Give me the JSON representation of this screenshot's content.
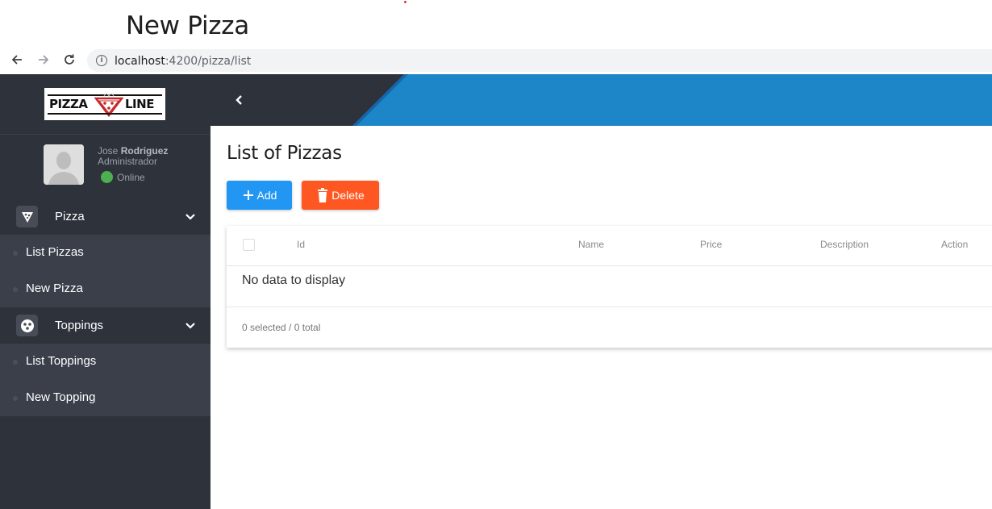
{
  "caption": {
    "title": "New Pizza"
  },
  "browser": {
    "url_host": "localhost",
    "url_path": ":4200/pizza/list"
  },
  "sidebar": {
    "logo": {
      "left_text": "PIZZA",
      "right_text": "LINE"
    },
    "user": {
      "first_name": "Jose",
      "last_name": "Rodriguez",
      "role": "Administrador",
      "status": "Online"
    },
    "groups": [
      {
        "label": "Pizza",
        "icon": "pizza-slice-icon",
        "items": [
          {
            "label": "List Pizzas"
          },
          {
            "label": "New Pizza"
          }
        ]
      },
      {
        "label": "Toppings",
        "icon": "toppings-icon",
        "items": [
          {
            "label": "List Toppings"
          },
          {
            "label": "New Topping"
          }
        ]
      }
    ]
  },
  "main": {
    "title": "List of Pizzas",
    "buttons": {
      "add": "Add",
      "delete": "Delete"
    },
    "table": {
      "columns": [
        "Id",
        "Name",
        "Price",
        "Description",
        "Action"
      ],
      "empty_message": "No data to display",
      "footer": "0 selected / 0 total"
    }
  },
  "colors": {
    "sidebar_bg": "#2e323b",
    "header_blue": "#1c86c8",
    "add_button": "#2196f3",
    "delete_button": "#ff5722",
    "online": "#4caf50"
  }
}
